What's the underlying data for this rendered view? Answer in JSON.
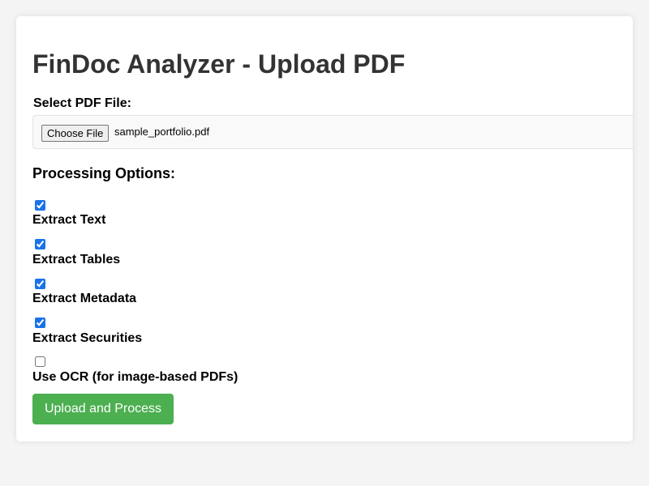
{
  "page": {
    "title": "FinDoc Analyzer - Upload PDF"
  },
  "file_input": {
    "label": "Select PDF File:",
    "button_label": "Choose File",
    "selected_file": "sample_portfolio.pdf"
  },
  "options": {
    "title": "Processing Options:",
    "items": [
      {
        "label": "Extract Text",
        "checked": true
      },
      {
        "label": "Extract Tables",
        "checked": true
      },
      {
        "label": "Extract Metadata",
        "checked": true
      },
      {
        "label": "Extract Securities",
        "checked": true
      },
      {
        "label": "Use OCR (for image-based PDFs)",
        "checked": false
      }
    ]
  },
  "actions": {
    "submit_label": "Upload and Process"
  },
  "colors": {
    "background": "#f4f4f4",
    "card": "#ffffff",
    "title": "#333333",
    "submit_button": "#4caf50",
    "checkbox_accent": "#1a73e8"
  }
}
